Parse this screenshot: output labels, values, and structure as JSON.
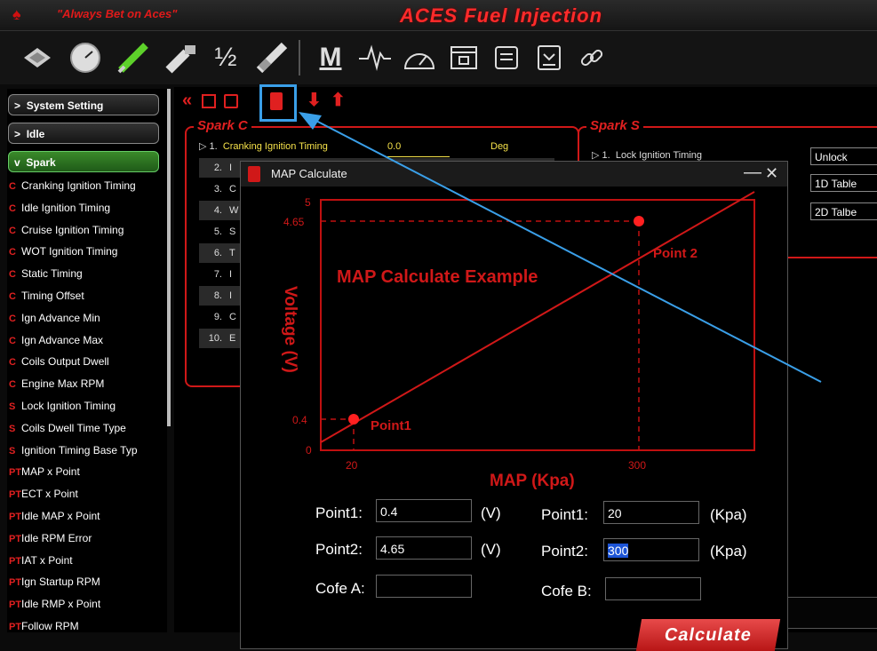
{
  "app": {
    "slogan": "\"Always Bet on Aces\"",
    "title": "ACES Fuel Injection"
  },
  "toolbar": {
    "icons": [
      "sensor-icon",
      "gauge-icon",
      "injector-icon",
      "coil-icon",
      "fraction-icon",
      "plug-icon",
      "m-icon",
      "waveform-icon",
      "speedometer-icon",
      "save-window-icon",
      "list-icon",
      "download-icon",
      "link-icon"
    ],
    "fraction_label": "½",
    "m_label": "M"
  },
  "sidebar": {
    "headers": [
      {
        "label": "System Setting",
        "chevron": ">"
      },
      {
        "label": "Idle",
        "chevron": ">"
      },
      {
        "label": "Spark",
        "chevron": "v"
      }
    ],
    "items": [
      {
        "tag": "C",
        "label": "Cranking Ignition Timing"
      },
      {
        "tag": "C",
        "label": "Idle Ignition Timing"
      },
      {
        "tag": "C",
        "label": "Cruise Ignition Timing"
      },
      {
        "tag": "C",
        "label": "WOT Ignition Timing"
      },
      {
        "tag": "C",
        "label": "Static Timing"
      },
      {
        "tag": "C",
        "label": "Timing Offset"
      },
      {
        "tag": "C",
        "label": "Ign Advance Min"
      },
      {
        "tag": "C",
        "label": "Ign Advance  Max"
      },
      {
        "tag": "C",
        "label": "Coils Output Dwell"
      },
      {
        "tag": "C",
        "label": "Engine Max RPM"
      },
      {
        "tag": "S",
        "label": "Lock Ignition Timing"
      },
      {
        "tag": "S",
        "label": "Coils Dwell Time Type"
      },
      {
        "tag": "S",
        "label": "Ignition Timing Base Typ"
      },
      {
        "tag": "PT",
        "label": "MAP x Point"
      },
      {
        "tag": "PT",
        "label": "ECT x Point"
      },
      {
        "tag": "PT",
        "label": "Idle MAP x Point"
      },
      {
        "tag": "PT",
        "label": "Idle RPM Error"
      },
      {
        "tag": "PT",
        "label": "IAT x Point"
      },
      {
        "tag": "PT",
        "label": "Ign Startup RPM"
      },
      {
        "tag": "PT",
        "label": "Idle RMP x Point"
      },
      {
        "tag": "PT",
        "label": "Follow RPM"
      }
    ]
  },
  "spark_c": {
    "title": "Spark C",
    "row1": {
      "num": "1.",
      "label": "Cranking Ignition Timing",
      "value": "0.0",
      "unit": "Deg"
    },
    "rows": [
      {
        "num": "2.",
        "label": "I"
      },
      {
        "num": "3.",
        "label": "C"
      },
      {
        "num": "4.",
        "label": "W"
      },
      {
        "num": "5.",
        "label": "S"
      },
      {
        "num": "6.",
        "label": "T"
      },
      {
        "num": "7.",
        "label": "I"
      },
      {
        "num": "8.",
        "label": "I"
      },
      {
        "num": "9.",
        "label": "C"
      },
      {
        "num": "10.",
        "label": "E"
      }
    ]
  },
  "spark_s": {
    "title": "Spark  S",
    "row1": {
      "num": "1.",
      "label": "Lock Ignition Timing"
    },
    "cells": [
      "Unlock",
      "1D Table",
      "2D Talbe"
    ]
  },
  "dialog": {
    "title": "MAP Calculate",
    "minimize": "—",
    "close": "✕",
    "example": {
      "heading": "MAP Calculate Example",
      "y_axis_label": "Voltage (V)",
      "x_axis_label": "MAP (Kpa)",
      "y_ticks": [
        "5",
        "4.65",
        "0.4",
        "0"
      ],
      "x_ticks": [
        "20",
        "300"
      ],
      "point1_label": "Point1",
      "point2_label": "Point 2"
    },
    "left_fields": [
      {
        "label": "Point1:",
        "value": "0.4",
        "unit": "(V)"
      },
      {
        "label": "Point2:",
        "value": "4.65",
        "unit": "(V)"
      },
      {
        "label": "Cofe A:",
        "value": "",
        "unit": ""
      }
    ],
    "right_fields": [
      {
        "label": "Point1:",
        "value": "20",
        "unit": "(Kpa)"
      },
      {
        "label": "Point2:",
        "value": "300",
        "unit": "(Kpa)"
      },
      {
        "label": "Cofe B:",
        "value": "",
        "unit": ""
      }
    ],
    "calculate_label": "Calculate"
  },
  "colors": {
    "accent_red": "#e01a1a",
    "highlight_blue": "#3a9fe8",
    "active_green": "#3a8a2a"
  }
}
